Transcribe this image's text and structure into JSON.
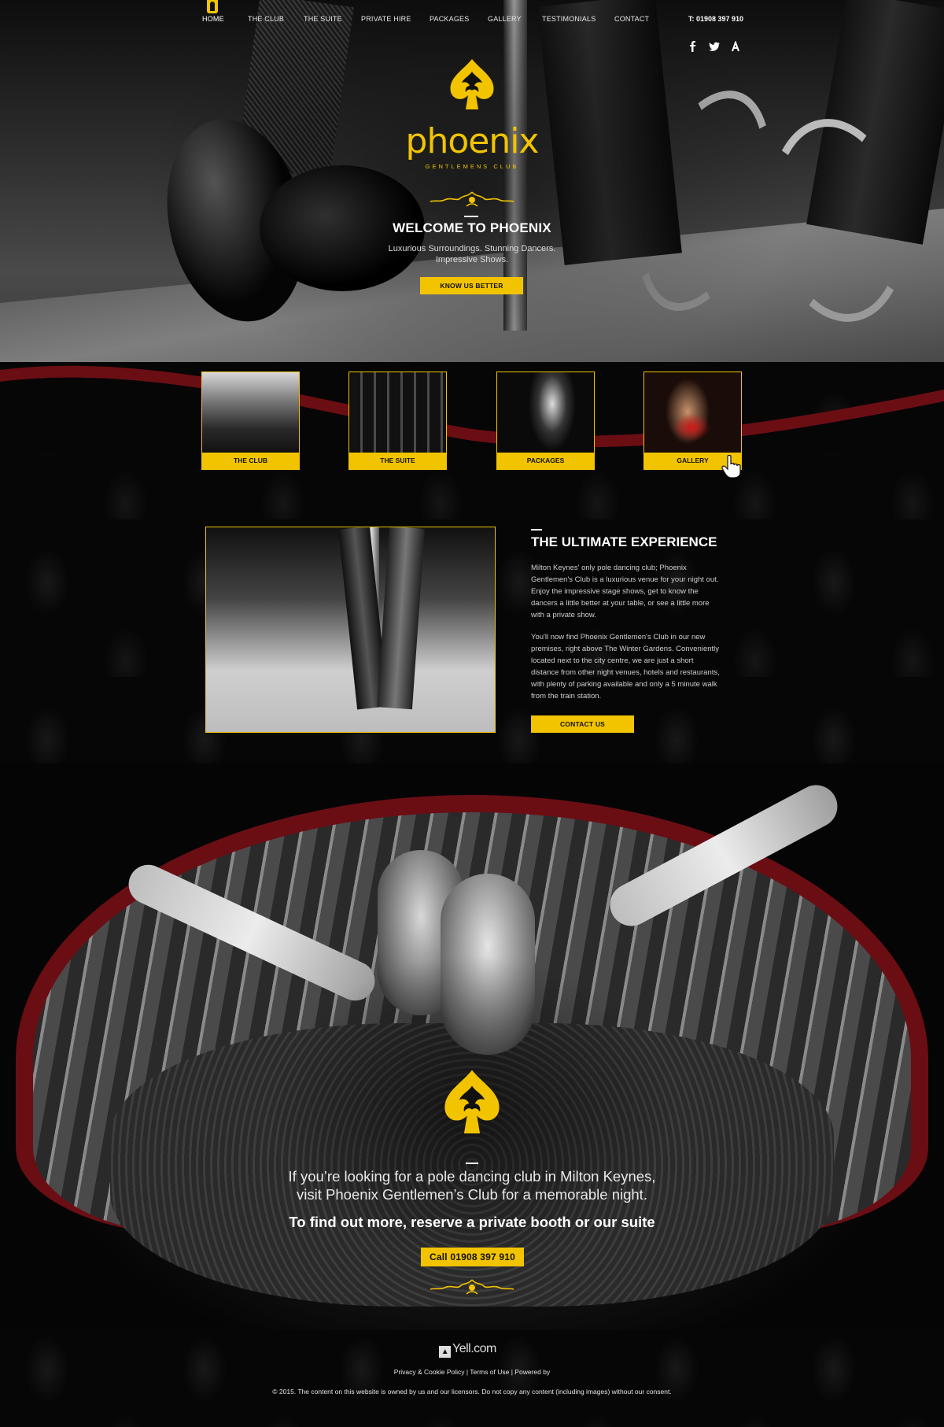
{
  "nav": {
    "items": [
      "HOME",
      "THE CLUB",
      "THE SUITE",
      "PRIVATE HIRE",
      "PACKAGES",
      "GALLERY",
      "TESTIMONIALS",
      "CONTACT"
    ],
    "phone": "T: 01908 397 910",
    "social": [
      "facebook-icon",
      "twitter-icon",
      "yell-icon"
    ]
  },
  "logo": {
    "word": "phoenix",
    "sub": "GENTLEMENS CLUB"
  },
  "hero": {
    "title": "WELCOME TO PHOENIX",
    "tagline_1": "Luxurious Surroundings. Stunning Dancers.",
    "tagline_2": "Impressive Shows.",
    "button": "KNOW US BETTER"
  },
  "cards": [
    {
      "label": "THE CLUB"
    },
    {
      "label": "THE SUITE"
    },
    {
      "label": "PACKAGES"
    },
    {
      "label": "GALLERY"
    }
  ],
  "ultimate": {
    "title": "THE ULTIMATE EXPERIENCE",
    "p1": "Milton Keynes' only pole dancing club; Phoenix Gentlemen's Club is a luxurious venue for your night out. Enjoy the impressive stage shows, get to know the dancers a little better at your table, or see a little more with a private show.",
    "p2": "You'll now find Phoenix Gentlemen's Club in our new premises, right above The Winter Gardens. Conveniently located next to the city centre, we are just a short distance from other night venues, hotels and restaurants, with plenty of parking available and only a 5 minute walk from the train station.",
    "button": "CONTACT US"
  },
  "cta": {
    "line1": "If you’re looking for a pole dancing club in Milton Keynes,",
    "line2": "visit Phoenix Gentlemen’s Club for a memorable night.",
    "strong": "To find out more, reserve a private booth or our suite",
    "button": "Call 01908 397 910"
  },
  "footer": {
    "yell": "Yell.com",
    "links": "Privacy & Cookie Policy | Terms of Use | Powered by",
    "copyright": "© 2015. The content on this website is owned by us and our licensors. Do not copy any content (including images) without our consent."
  },
  "colors": {
    "accent": "#f2c400",
    "background": "#050505",
    "wave": "#6a0e14"
  }
}
